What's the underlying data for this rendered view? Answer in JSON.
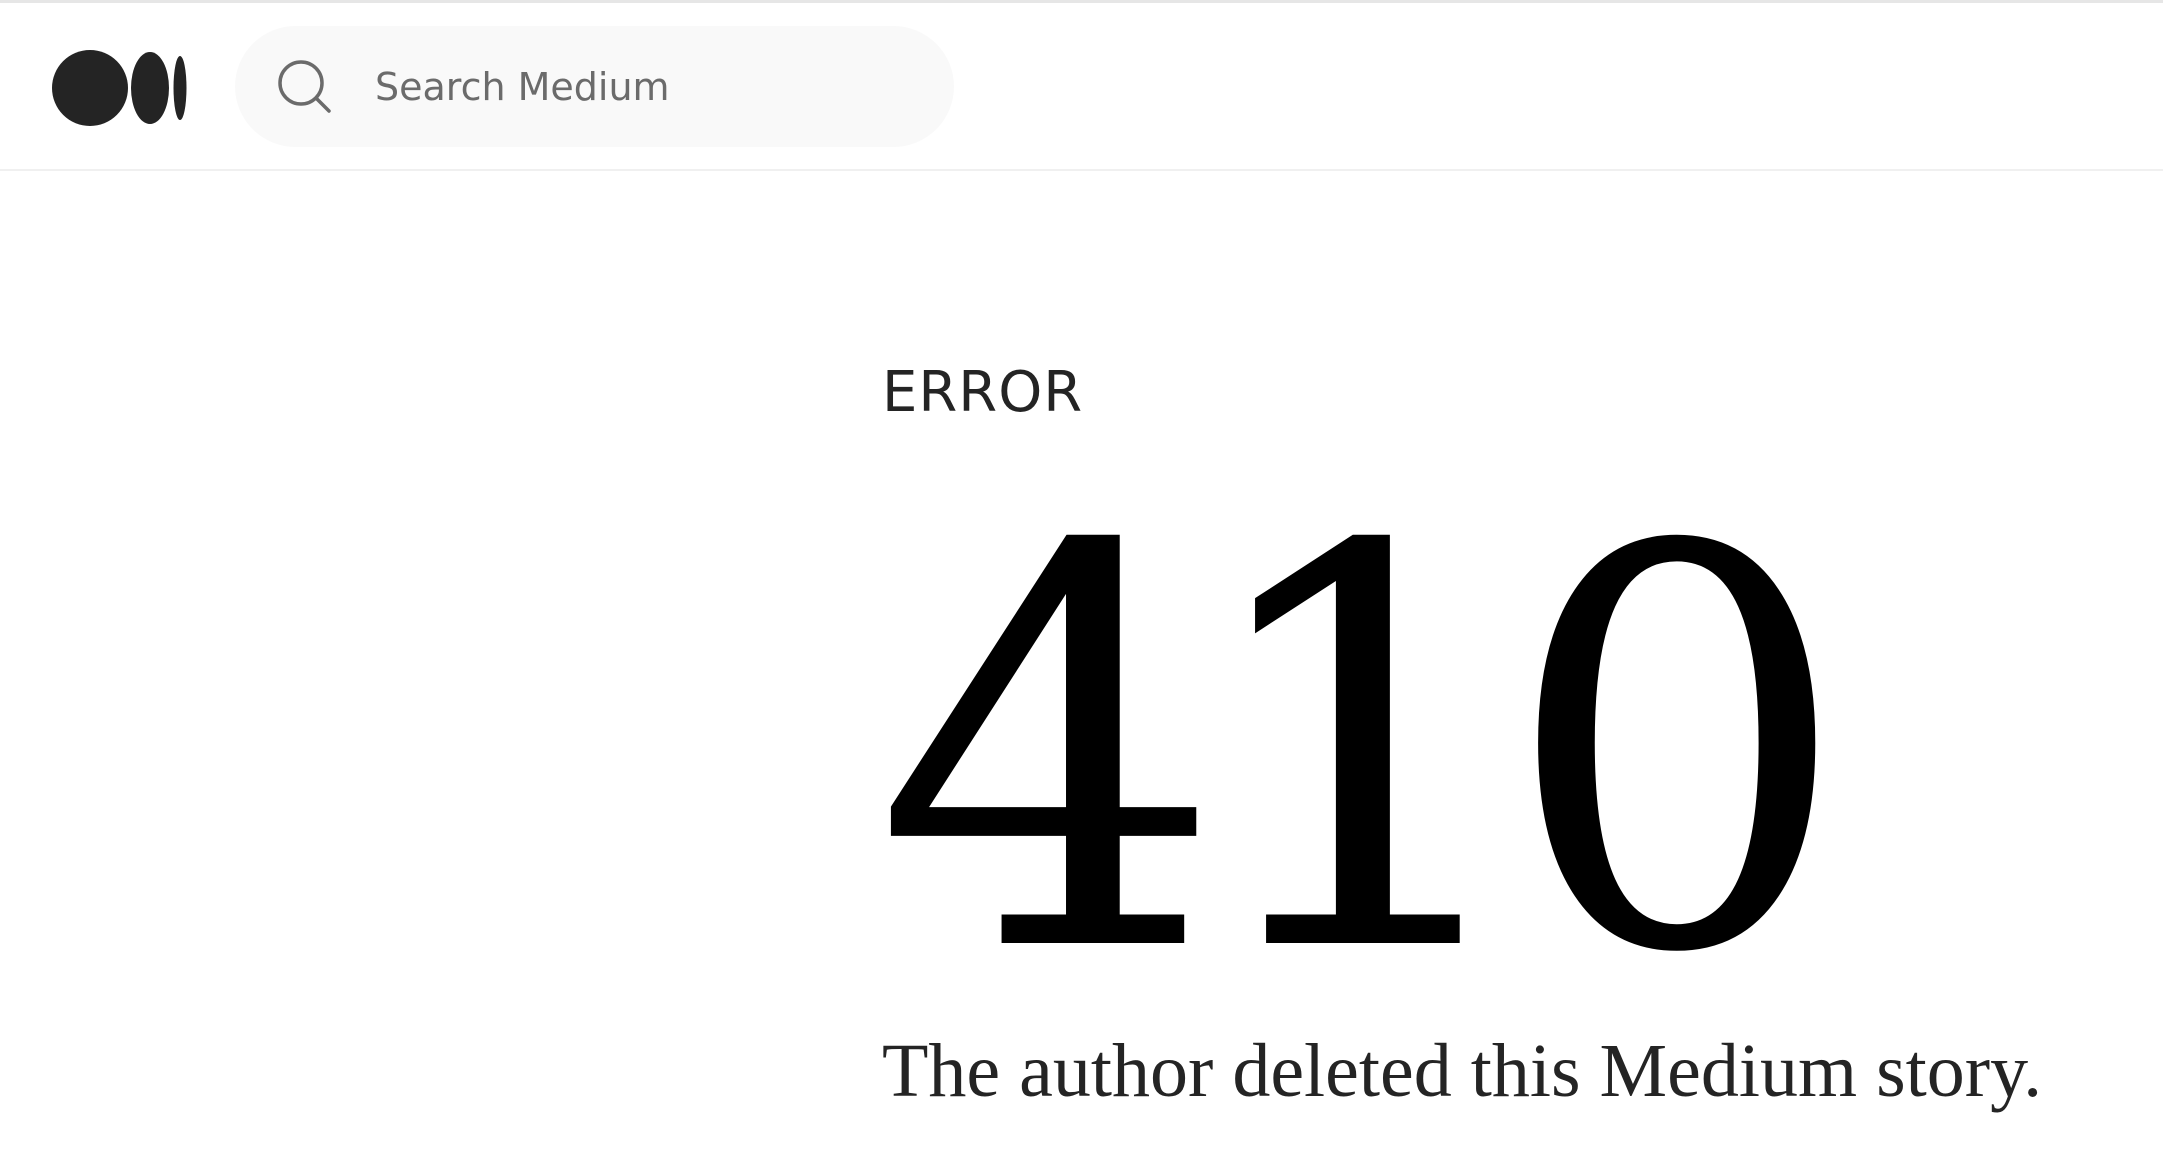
{
  "header": {
    "logo_icon": "medium-logo-icon",
    "search": {
      "icon": "search-icon",
      "placeholder": "Search Medium",
      "value": ""
    }
  },
  "main": {
    "label": "ERROR",
    "code": "410",
    "message": "The author deleted this Medium story."
  },
  "colors": {
    "text_dark": "#242424",
    "code": "#000000",
    "search_bg": "#f9f9f9",
    "placeholder": "#6b6b6b"
  }
}
